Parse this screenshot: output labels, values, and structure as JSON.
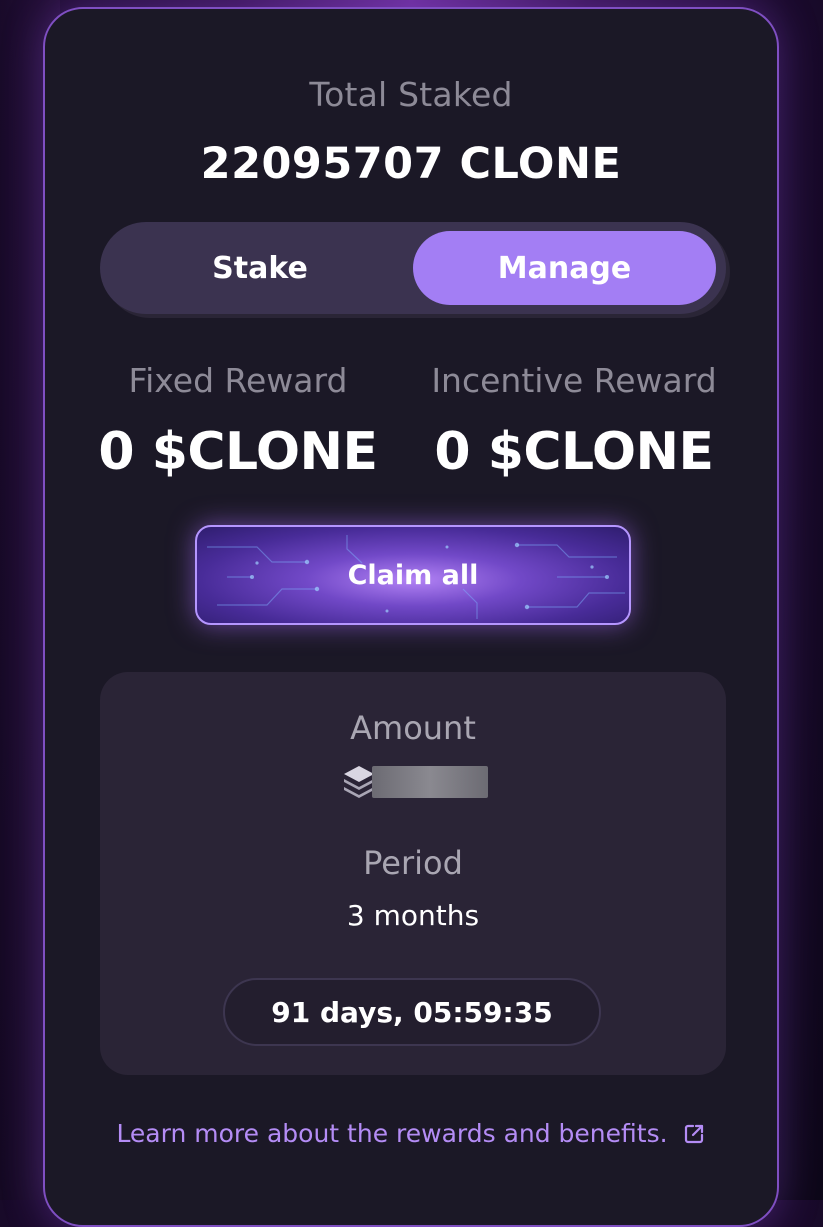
{
  "staking": {
    "total_label": "Total Staked",
    "total_value": "22095707 CLONE"
  },
  "toggle": {
    "stake_label": "Stake",
    "manage_label": "Manage",
    "active_tab": "Manage"
  },
  "rewards": {
    "fixed_label": "Fixed Reward",
    "fixed_value": "0 $CLONE",
    "incentive_label": "Incentive Reward",
    "incentive_value": "0 $CLONE"
  },
  "claim": {
    "label": "Claim all"
  },
  "position": {
    "amount_label": "Amount",
    "amount_icon": "stack-layers-icon",
    "period_label": "Period",
    "period_value": "3 months",
    "countdown": "91 days, 05:59:35"
  },
  "footer": {
    "learn_more": "Learn more about the rewards and benefits.",
    "link_icon": "external-link-icon"
  },
  "colors": {
    "accent": "#a37ef4",
    "card_bg": "#1b1826",
    "panel_bg": "#2a2436",
    "link": "#b48cf5"
  }
}
